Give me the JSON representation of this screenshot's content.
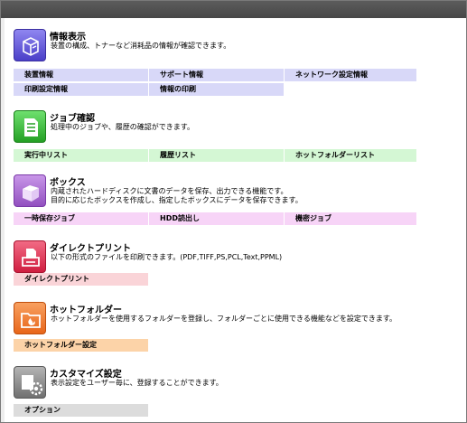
{
  "sections": [
    {
      "title": "情報表示",
      "desc": "装置の構成、トナーなど消耗品の情報が確認できます。",
      "links": [
        "装置情報",
        "サポート情報",
        "ネットワーク設定情報",
        "印刷設定情報",
        "情報の印刷"
      ],
      "color": "#d8d8f8",
      "icon": "device-info-icon",
      "icon_color": "#5a4fd6"
    },
    {
      "title": "ジョブ確認",
      "desc": "処理中のジョブや、履歴の確認ができます。",
      "links": [
        "実行中リスト",
        "履歴リスト",
        "ホットフォルダーリスト"
      ],
      "color": "#d4f7d4",
      "icon": "job-document-icon",
      "icon_color": "#2fb52f"
    },
    {
      "title": "ボックス",
      "desc_lines": [
        "内蔵されたハードディスクに文書のデータを保存、出力できる機能です。",
        "目的に応じたボックスを作成し、指定したボックスにデータを保存できます。"
      ],
      "links": [
        "一時保存ジョブ",
        "HDD読出し",
        "機密ジョブ"
      ],
      "color": "#f7d4f7",
      "icon": "box-icon",
      "icon_color": "#a05ec8"
    },
    {
      "title": "ダイレクトプリント",
      "desc": "以下の形式のファイルを印刷できます。(PDF,TIFF,PS,PCL,Text,PPML)",
      "links": [
        "ダイレクトプリント"
      ],
      "color": "#fad4d8",
      "icon": "direct-print-icon",
      "icon_color": "#e0304f"
    },
    {
      "title": "ホットフォルダー",
      "desc": "ホットフォルダーを使用するフォルダーを登録し、フォルダーごとに使用できる機能などを設定できます。",
      "links": [
        "ホットフォルダー設定"
      ],
      "color": "#fcd3a8",
      "icon": "hot-folder-icon",
      "icon_color": "#f07a28"
    },
    {
      "title": "カスタマイズ設定",
      "desc": "表示設定をユーザー毎に、登録することができます。",
      "links": [
        "オプション"
      ],
      "color": "#dcdcdc",
      "icon": "customize-settings-icon",
      "icon_color": "#808080"
    }
  ]
}
